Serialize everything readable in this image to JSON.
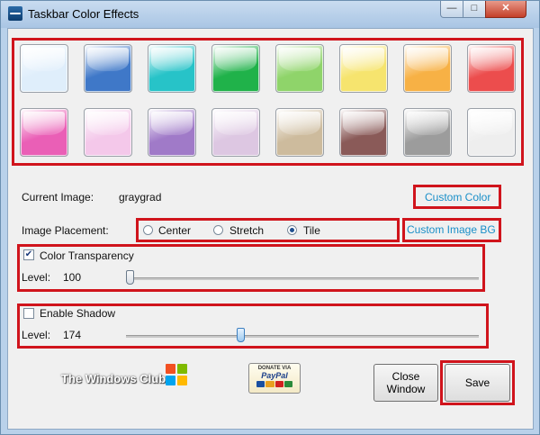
{
  "window": {
    "title": "Taskbar Color Effects"
  },
  "swatches": [
    {
      "name": "swatch-ice",
      "color": "#dfeefb"
    },
    {
      "name": "swatch-blue",
      "color": "#3f78c8"
    },
    {
      "name": "swatch-cyan",
      "color": "#27c3c8"
    },
    {
      "name": "swatch-green",
      "color": "#20b24a"
    },
    {
      "name": "swatch-lime",
      "color": "#8fd46a"
    },
    {
      "name": "swatch-yellow",
      "color": "#f6e46e"
    },
    {
      "name": "swatch-orange",
      "color": "#f7b145"
    },
    {
      "name": "swatch-red",
      "color": "#ec4d4d"
    },
    {
      "name": "swatch-magenta",
      "color": "#ea5fb6"
    },
    {
      "name": "swatch-pink",
      "color": "#f4c8ea"
    },
    {
      "name": "swatch-purple",
      "color": "#a07ac8"
    },
    {
      "name": "swatch-lavender",
      "color": "#ddc7e2"
    },
    {
      "name": "swatch-beige",
      "color": "#cdbb9d"
    },
    {
      "name": "swatch-brown",
      "color": "#8a5a58"
    },
    {
      "name": "swatch-gray",
      "color": "#9c9c9c"
    },
    {
      "name": "swatch-white",
      "color": "#eeeeee"
    }
  ],
  "current_image": {
    "label": "Current Image:",
    "value": "graygrad"
  },
  "custom_color": "Custom Color",
  "custom_image_bg": "Custom Image BG",
  "placement": {
    "label": "Image Placement:",
    "options": [
      "Center",
      "Stretch",
      "Tile"
    ],
    "selected": "Tile"
  },
  "transparency": {
    "label": "Color Transparency",
    "checked": true,
    "level_label": "Level:",
    "level_value": "100",
    "slider_fraction": 0.0
  },
  "shadow": {
    "label": "Enable Shadow",
    "checked": false,
    "level_label": "Level:",
    "level_value": "174",
    "slider_fraction": 0.32
  },
  "logo": {
    "text": "The Windows Club"
  },
  "paypal": {
    "top": "DONATE VIA",
    "brand": "PayPal"
  },
  "buttons": {
    "close": "Close Window",
    "close_line1": "Close",
    "close_line2": "Window",
    "save": "Save"
  },
  "highlight_color": "#d0141c"
}
